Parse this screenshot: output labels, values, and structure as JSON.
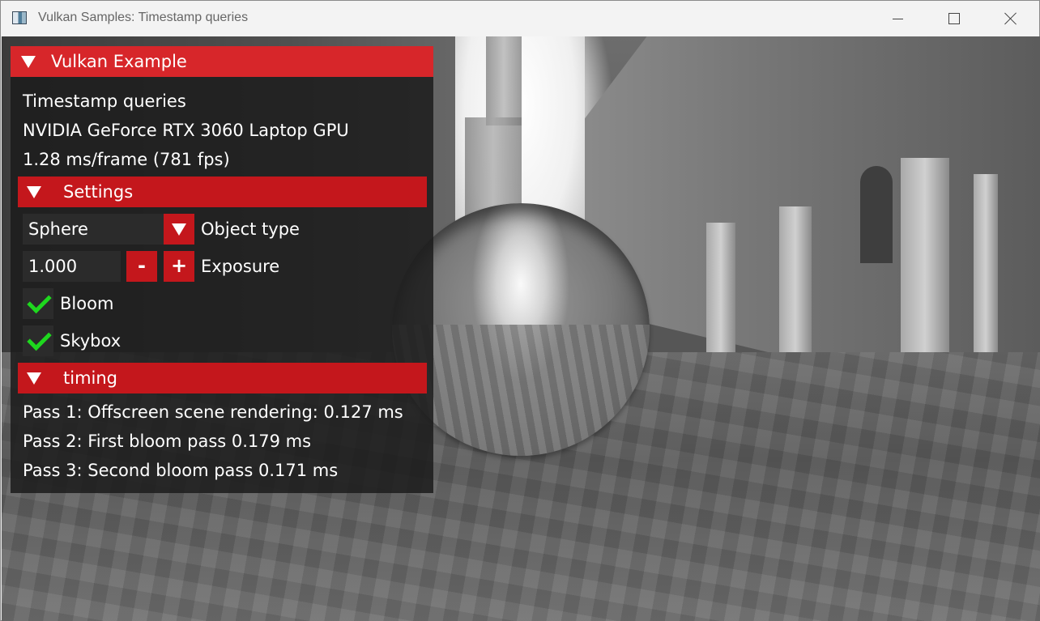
{
  "window": {
    "title": "Vulkan Samples: Timestamp queries",
    "icon": "app-window-icon",
    "controls": [
      "minimize-icon",
      "maximize-icon",
      "close-icon"
    ]
  },
  "gui": {
    "header_title": "Vulkan Example",
    "sample_name": "Timestamp queries",
    "gpu_name": "NVIDIA GeForce RTX 3060 Laptop GPU",
    "frame_stats": "1.28 ms/frame (781 fps)",
    "settings": {
      "title": "Settings",
      "object_type_value": "Sphere",
      "object_type_label": "Object type",
      "exposure_value": "1.000",
      "exposure_minus": "-",
      "exposure_plus": "+",
      "exposure_label": "Exposure",
      "bloom_label": "Bloom",
      "bloom_checked": true,
      "skybox_label": "Skybox",
      "skybox_checked": true
    },
    "timing": {
      "title": "timing",
      "pass1": "Pass 1: Offscreen scene rendering: 0.127 ms",
      "pass2": "Pass 2: First bloom pass 0.179 ms",
      "pass3": "Pass 3: Second bloom pass 0.171 ms"
    },
    "colors": {
      "header": "#d7262a",
      "section": "#c4171c",
      "check": "#1ed81e",
      "panel": "#1c1c1c"
    }
  }
}
